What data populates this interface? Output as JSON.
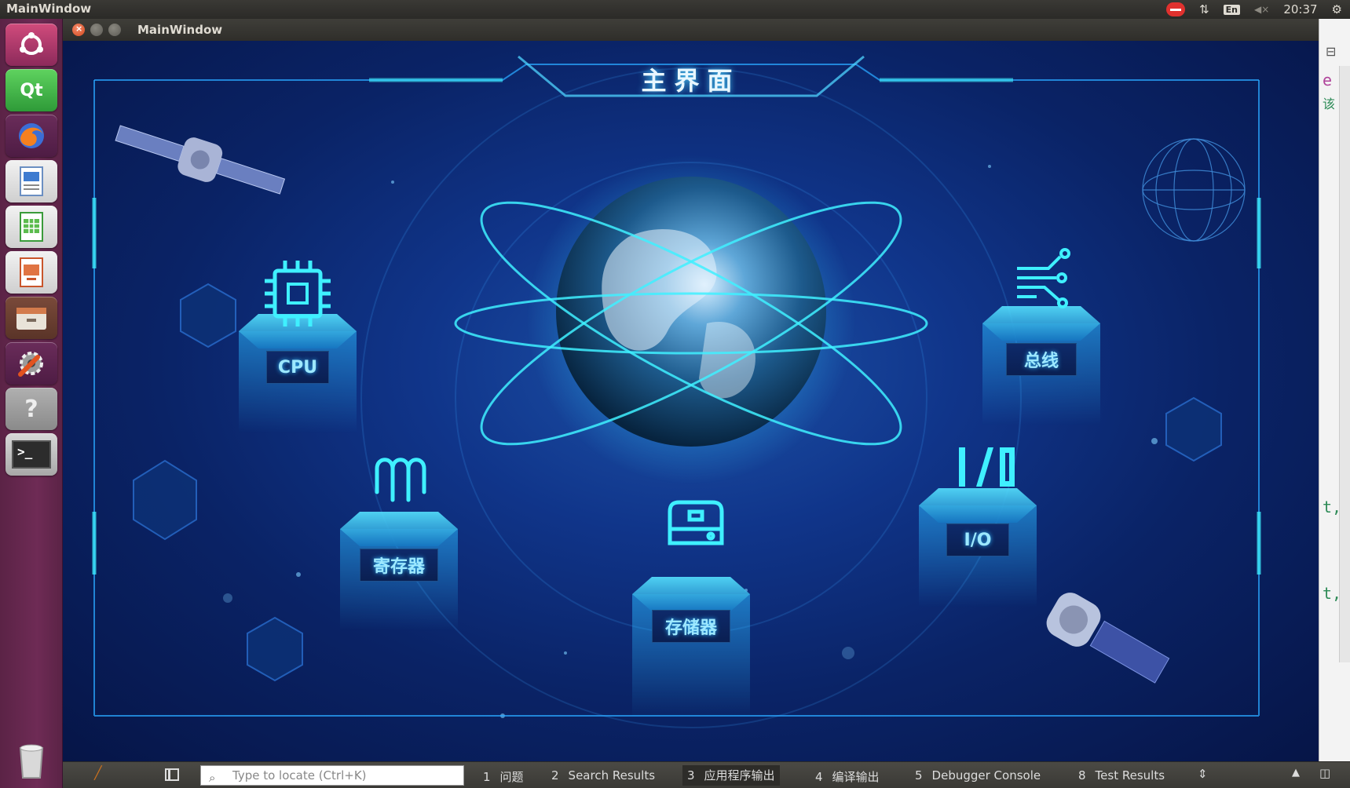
{
  "system_panel": {
    "app_title": "MainWindow",
    "language": "En",
    "volume": "◀×",
    "clock": "20:37"
  },
  "window": {
    "title": "MainWindow",
    "close_glyph": "×"
  },
  "scene": {
    "heading": "主界面",
    "modules": [
      {
        "id": "cpu",
        "label": "CPU",
        "icon": "cpu-chip-icon"
      },
      {
        "id": "bus",
        "label": "总线",
        "icon": "bus-circuit-icon"
      },
      {
        "id": "register",
        "label": "寄存器",
        "icon": "register-icon"
      },
      {
        "id": "storage",
        "label": "存储器",
        "icon": "storage-drive-icon"
      },
      {
        "id": "io",
        "label": "I/O",
        "icon": "io-icon"
      }
    ],
    "colors": {
      "background": "#0a2366",
      "accent": "#3ff0ff",
      "label_text": "#9de8ff"
    }
  },
  "launcher": {
    "items": [
      {
        "name": "ubuntu-dash-icon",
        "glyph": "◎"
      },
      {
        "name": "qt-creator-icon",
        "glyph": "Qt"
      },
      {
        "name": "firefox-icon",
        "glyph": "●"
      },
      {
        "name": "writer-icon",
        "glyph": "▤"
      },
      {
        "name": "calc-icon",
        "glyph": "▦"
      },
      {
        "name": "impress-icon",
        "glyph": "▣"
      },
      {
        "name": "files-icon",
        "glyph": "▭"
      },
      {
        "name": "settings-icon",
        "glyph": "⚙"
      },
      {
        "name": "help-icon",
        "glyph": "?"
      },
      {
        "name": "terminal-icon",
        "glyph": ">_"
      },
      {
        "name": "trash-icon",
        "glyph": "🗑"
      }
    ]
  },
  "ide": {
    "code_fragments": [
      "e",
      "该",
      "t,",
      "t,"
    ]
  },
  "output_bar": {
    "locate_placeholder": "Type to locate (Ctrl+K)",
    "tabs": [
      {
        "num": "1",
        "label": "问题"
      },
      {
        "num": "2",
        "label": "Search Results"
      },
      {
        "num": "3",
        "label": "应用程序输出"
      },
      {
        "num": "4",
        "label": "编译输出"
      },
      {
        "num": "5",
        "label": "Debugger Console"
      },
      {
        "num": "8",
        "label": "Test Results"
      }
    ],
    "active_tab": "3"
  }
}
